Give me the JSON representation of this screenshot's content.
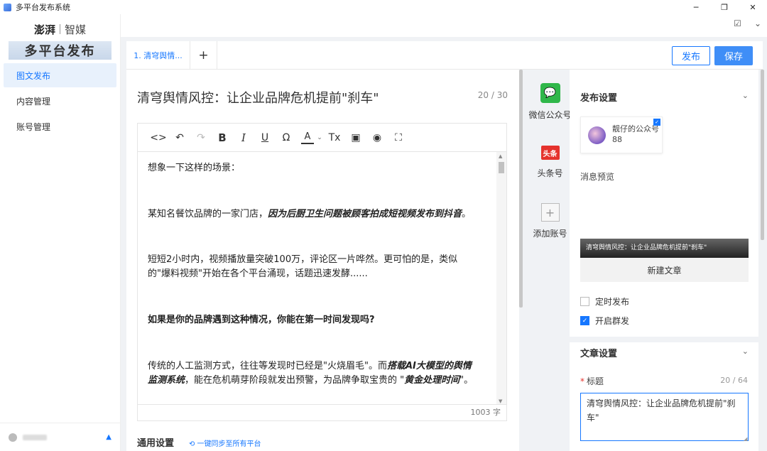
{
  "window": {
    "title": "多平台发布系统",
    "minimize": "─",
    "restore": "❐",
    "close": "✕"
  },
  "sidebar": {
    "logo_primary": "澎湃",
    "logo_secondary": "智媒",
    "banner": "多平台发布",
    "items": [
      {
        "label": "图文发布",
        "active": true
      },
      {
        "label": "内容管理",
        "active": false
      },
      {
        "label": "账号管理",
        "active": false
      }
    ]
  },
  "header": {
    "notes_icon": "☑",
    "chevron_icon": "⌄"
  },
  "tabs": {
    "items": [
      {
        "label": "1. 清穹舆情..."
      }
    ],
    "add": "+"
  },
  "actions": {
    "publish": "发布",
    "save": "保存"
  },
  "editor": {
    "title": "清穹舆情风控：让企业品牌危机提前\"刹车\"",
    "title_count": "20 / 30",
    "toolbar": {
      "code": "<>",
      "undo": "↶",
      "redo": "↷",
      "bold": "B",
      "italic": "I",
      "underline": "U",
      "omega": "Ω",
      "font_color": "A",
      "font_color_chevron": "⌄",
      "clear_format": "Tx",
      "image": "▣",
      "preview": "◉",
      "fullscreen": "⛶"
    },
    "paragraphs": {
      "p1": "想象一下这样的场景：",
      "p2_a": "某知名餐饮品牌的一家门店，",
      "p2_b": "因为后厨卫生问题被顾客拍成短视频发布到抖音",
      "p2_c": "。",
      "p3_a": "短短2小时内，视频播放量突破100万，评论区一片哗然。更可怕的是，类似",
      "p3_b": "的\"爆料视频\"开始在各个平台涌现，话题迅速发酵......",
      "p4": "如果是你的品牌遇到这种情况，你能在第一时间发现吗?",
      "p5_a": "传统的人工监测方式，往往等发现时已经是\"火烧眉毛\"。而",
      "p5_b": "搭载AI大模型的舆情",
      "p5_c": "监测系统",
      "p5_d": "，能在危机萌芽阶段就发出预警，为品牌争取宝贵的 \"",
      "p5_e": "黄金处理时间",
      "p5_f": "\"。"
    },
    "word_count": "1003 字",
    "general_settings": "通用设置",
    "sync_link": "⟲ 一键同步至所有平台"
  },
  "platforms": [
    {
      "label": "微信公众号",
      "icon": "wechat-icon",
      "color": "#2fb74a"
    },
    {
      "label": "头条号",
      "badge": "头条",
      "icon": "toutiao-icon",
      "color": "#e5322d"
    },
    {
      "label": "添加账号",
      "icon": "plus-icon"
    }
  ],
  "publish_settings": {
    "heading": "发布设置",
    "account": {
      "name": "靓仔的公众号88",
      "checked": true
    },
    "preview_label": "消息预览",
    "preview_title": "清穹舆情风控：让企业品牌危机提前\"刹车\"",
    "new_article": "新建文章",
    "scheduled": {
      "label": "定时发布",
      "checked": false
    },
    "mass_send": {
      "label": "开启群发",
      "checked": true
    }
  },
  "article_settings": {
    "heading": "文章设置",
    "title_label": "标题",
    "required_mark": "*",
    "title_count": "20 / 64",
    "title_value": "清穹舆情风控：让企业品牌危机提前\"刹车\""
  },
  "colors": {
    "accent": "#1677ff",
    "save_button": "#3f8ef7",
    "wechat": "#2fb74a",
    "toutiao": "#e5322d"
  }
}
